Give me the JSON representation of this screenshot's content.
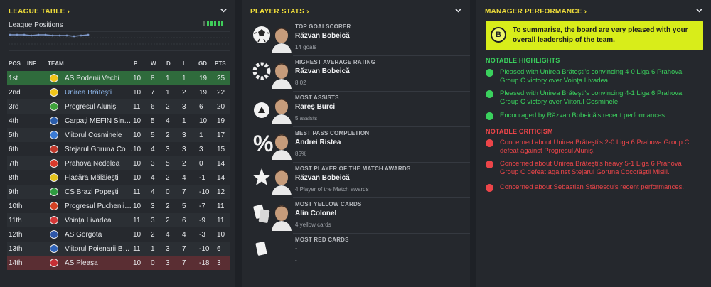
{
  "league_table": {
    "title": "LEAGUE TABLE",
    "positions_label": "League Positions",
    "headers": {
      "pos": "POS",
      "inf": "INF",
      "team": "TEAM",
      "p": "P",
      "w": "W",
      "d": "D",
      "l": "L",
      "gd": "GD",
      "pts": "PTS"
    },
    "rows": [
      {
        "pos": "1st",
        "team": "AS Podenii Vechi",
        "p": "10",
        "w": "8",
        "d": "1",
        "l": "1",
        "gd": "19",
        "pts": "25",
        "color": "#f0c419"
      },
      {
        "pos": "2nd",
        "team": "Unirea Brăteşti",
        "p": "10",
        "w": "7",
        "d": "1",
        "l": "2",
        "gd": "19",
        "pts": "22",
        "color": "#f0c419"
      },
      {
        "pos": "3rd",
        "team": "Progresul Aluniş",
        "p": "11",
        "w": "6",
        "d": "2",
        "l": "3",
        "gd": "6",
        "pts": "20",
        "color": "#3ea23a"
      },
      {
        "pos": "4th",
        "team": "Carpaţi MEFIN Sinaia",
        "p": "10",
        "w": "5",
        "d": "4",
        "l": "1",
        "gd": "10",
        "pts": "19",
        "color": "#2b5dab"
      },
      {
        "pos": "5th",
        "team": "Viitorul Cosminele",
        "p": "10",
        "w": "5",
        "d": "2",
        "l": "3",
        "gd": "1",
        "pts": "17",
        "color": "#3a7bd5"
      },
      {
        "pos": "6th",
        "team": "Stejarul Goruna Cocorăştii Mislii",
        "p": "10",
        "w": "4",
        "d": "3",
        "l": "3",
        "gd": "3",
        "pts": "15",
        "color": "#c0392b"
      },
      {
        "pos": "7th",
        "team": "Prahova Nedelea",
        "p": "10",
        "w": "3",
        "d": "5",
        "l": "2",
        "gd": "0",
        "pts": "14",
        "color": "#d93a2b"
      },
      {
        "pos": "8th",
        "team": "Flacăra Mălăieşti",
        "p": "10",
        "w": "4",
        "d": "2",
        "l": "4",
        "gd": "-1",
        "pts": "14",
        "color": "#e3c21c"
      },
      {
        "pos": "9th",
        "team": "CS Brazi Popeşti",
        "p": "11",
        "w": "4",
        "d": "0",
        "l": "7",
        "gd": "-10",
        "pts": "12",
        "color": "#2e9b40"
      },
      {
        "pos": "10th",
        "team": "Progresul Puchenii Mari",
        "p": "10",
        "w": "3",
        "d": "2",
        "l": "5",
        "gd": "-7",
        "pts": "11",
        "color": "#d54224"
      },
      {
        "pos": "11th",
        "team": "Voinţa Livadea",
        "p": "11",
        "w": "3",
        "d": "2",
        "l": "6",
        "gd": "-9",
        "pts": "11",
        "color": "#d43838"
      },
      {
        "pos": "12th",
        "team": "AS Gorgota",
        "p": "10",
        "w": "2",
        "d": "4",
        "l": "4",
        "gd": "-3",
        "pts": "10",
        "color": "#2d56a8"
      },
      {
        "pos": "13th",
        "team": "Viitorul Poienarii Burchii",
        "p": "11",
        "w": "1",
        "d": "3",
        "l": "7",
        "gd": "-10",
        "pts": "6",
        "color": "#2f63b8"
      },
      {
        "pos": "14th",
        "team": "AS Pleaşa",
        "p": "10",
        "w": "0",
        "d": "3",
        "l": "7",
        "gd": "-18",
        "pts": "3",
        "color": "#c62f35"
      }
    ]
  },
  "player_stats": {
    "title": "PLAYER STATS",
    "items": [
      {
        "label": "TOP GOALSCORER",
        "name": "Răzvan Bobeică",
        "sub": "14 goals",
        "icon": "football-icon"
      },
      {
        "label": "HIGHEST AVERAGE RATING",
        "name": "Răzvan Bobeică",
        "sub": "8.02",
        "icon": "gear-rating-icon"
      },
      {
        "label": "MOST ASSISTS",
        "name": "Rareş Burci",
        "sub": "5 assists",
        "icon": "assist-ball-icon"
      },
      {
        "label": "BEST PASS COMPLETION",
        "name": "Andrei Ristea",
        "sub": "85%",
        "icon": "percent-icon"
      },
      {
        "label": "MOST PLAYER OF THE MATCH AWARDS",
        "name": "Răzvan Bobeică",
        "sub": "4 Player of the Match awards",
        "icon": "star-icon"
      },
      {
        "label": "MOST YELLOW CARDS",
        "name": "Alin Colonel",
        "sub": "4 yellow cards",
        "icon": "cards-icon"
      },
      {
        "label": "MOST RED CARDS",
        "name": "-",
        "sub": "-",
        "icon": "card-icon"
      }
    ]
  },
  "manager": {
    "title": "MANAGER PERFORMANCE",
    "grade": "B",
    "summary": "To summarise, the board are very pleased with your overall leadership of the team.",
    "highlights_title": "NOTABLE HIGHLIGHTS",
    "highlights": [
      "Pleased with Unirea Brăteşti's convincing 4-0 Liga 6 Prahova Group C victory over Voinţa Livadea.",
      "Pleased with Unirea Brăteşti's convincing 4-1 Liga 6 Prahova Group C victory over Viitorul Cosminele.",
      "Encouraged by Răzvan Bobeică's recent performances."
    ],
    "criticism_title": "NOTABLE CRITICISM",
    "criticism": [
      "Concerned about Unirea Brăteşti's 2-0 Liga 6 Prahova Group C defeat against Progresul Aluniş.",
      "Concerned about Unirea Brăteşti's heavy 5-1 Liga 6 Prahova Group C defeat against Stejarul Goruna Cocorăştii Mislii.",
      "Concerned about Sebastian Stănescu's recent performances."
    ]
  },
  "colors": {
    "accent": "#f0de3a",
    "positive": "#3ad15d",
    "negative": "#ec4549",
    "summary_bg": "#d8ed1a"
  }
}
